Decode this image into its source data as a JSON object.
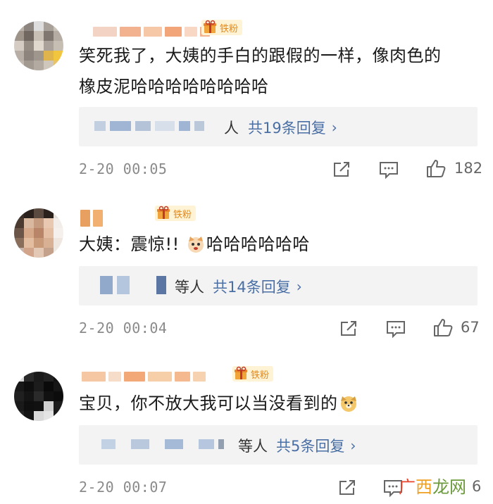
{
  "comments": [
    {
      "badge": "铁粉",
      "text_line1": "笑死我了，大姨的手白的跟假的一样，像肉色的",
      "text_line2": "橡皮泥哈哈哈哈哈哈哈哈",
      "reply_suffix": "人",
      "reply_count_label": "共19条回复",
      "timestamp": "2-20 00:05",
      "likes": "182"
    },
    {
      "badge": "铁粉",
      "text_before_emoji": "大姨：震惊!! ",
      "text_after_emoji": "哈哈哈哈哈哈",
      "reply_suffix": "等人",
      "reply_count_label": "共14条回复",
      "timestamp": "2-20 00:04",
      "likes": "67"
    },
    {
      "badge": "铁粉",
      "text": "宝贝，你不放大我可以当没看到的",
      "reply_suffix": "等人",
      "reply_count_label": "共5条回复",
      "timestamp": "2-20 00:07",
      "likes": "6"
    }
  ],
  "watermark": {
    "char1": "广",
    "char2": "西",
    "char3": "龙网",
    "colors": [
      "#e8452c",
      "#f0a020",
      "#6a9a3a"
    ]
  },
  "chevron": "›",
  "colors": {
    "link": "#4a6fa5",
    "meta": "#8a8a8a",
    "badge_text": "#e08a1e",
    "badge_bg": "#fff3d6",
    "reply_bg": "#f3f3f3"
  },
  "icons": [
    "share-icon",
    "comment-icon",
    "thumbs-up-icon",
    "gift-icon",
    "cat-emoji-icon",
    "dog-emoji-icon"
  ]
}
